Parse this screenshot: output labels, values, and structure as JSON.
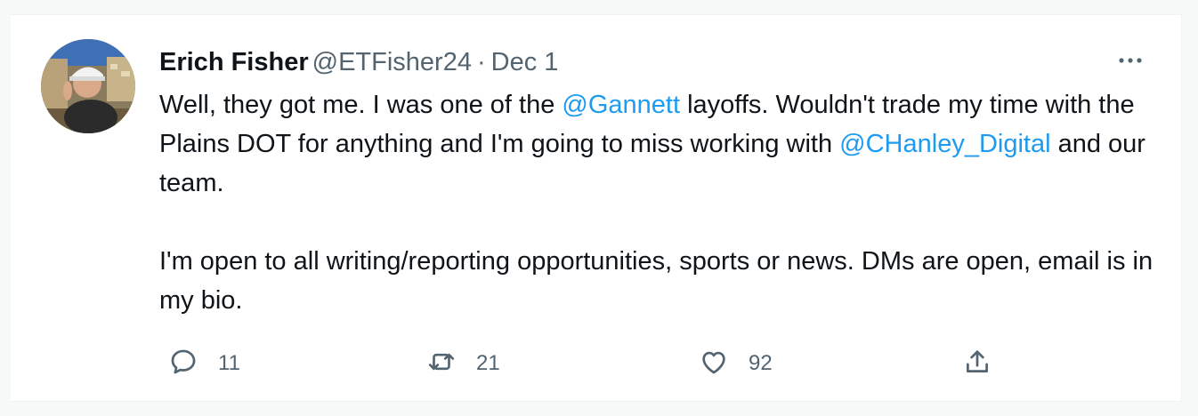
{
  "tweet": {
    "author": {
      "name": "Erich Fisher",
      "handle": "@ETFisher24"
    },
    "separator": "·",
    "date": "Dec 1",
    "paragraph1": {
      "t1": "Well, they got me. I was one of the ",
      "mention1": "@Gannett",
      "t2": " layoffs. Wouldn't trade my time with the Plains DOT for anything and I'm going to miss working with ",
      "mention2": "@CHanley_Digital",
      "t3": " and our team."
    },
    "paragraph2": "I'm open to all writing/reporting opportunities, sports or news. DMs are open, email is in my bio.",
    "actions": {
      "replies": "11",
      "retweets": "21",
      "likes": "92"
    }
  },
  "icons": {
    "more": "more-dots-icon",
    "reply": "reply-bubble-icon",
    "retweet": "retweet-icon",
    "like": "heart-icon",
    "share": "share-upload-icon"
  },
  "colors": {
    "mention": "#1d9bf0",
    "secondary_text": "#536471",
    "primary_text": "#0f1419",
    "background": "#f7f9f9",
    "card": "#ffffff"
  }
}
